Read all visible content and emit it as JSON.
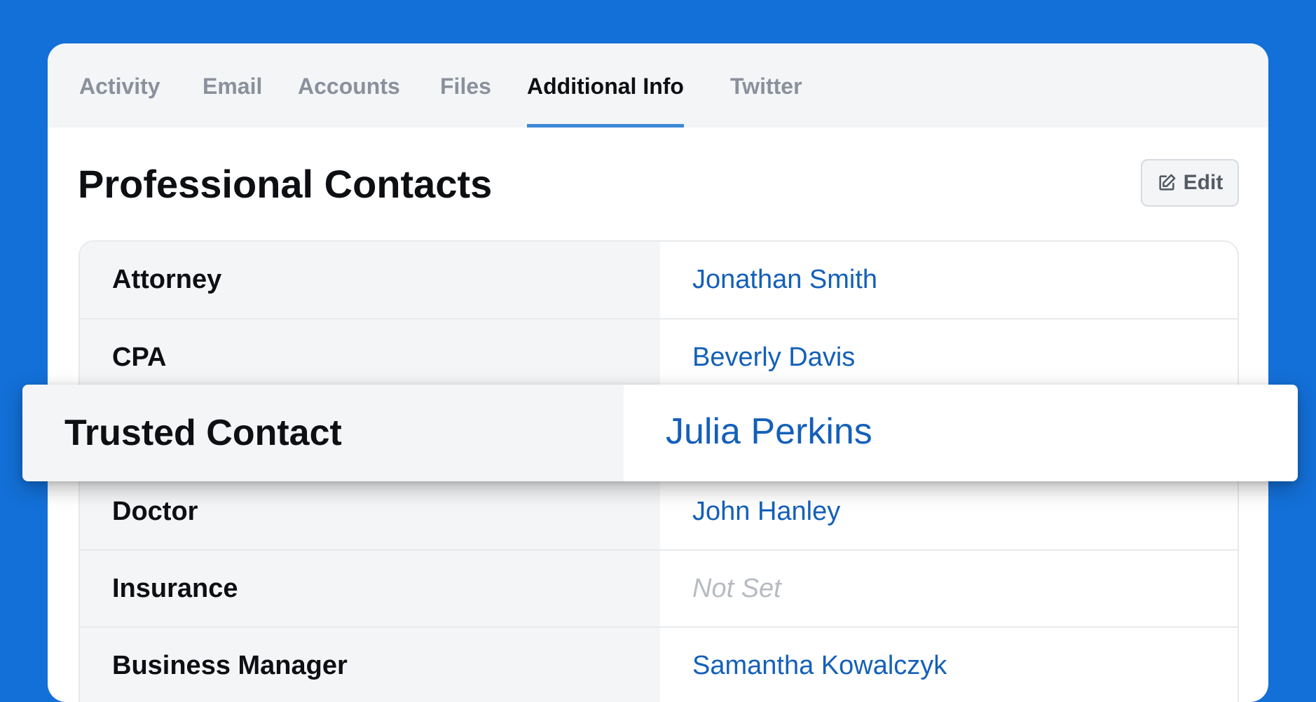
{
  "tabs": [
    {
      "label": "Activity"
    },
    {
      "label": "Email"
    },
    {
      "label": "Accounts"
    },
    {
      "label": "Files"
    },
    {
      "label": "Additional Info"
    },
    {
      "label": "Twitter"
    }
  ],
  "active_tab": "Additional Info",
  "section": {
    "title": "Professional Contacts",
    "edit_label": "Edit"
  },
  "contacts": [
    {
      "role": "Attorney",
      "name": "Jonathan Smith"
    },
    {
      "role": "CPA",
      "name": "Beverly Davis"
    },
    {
      "role": "Trusted Contact",
      "name": "Julia Perkins"
    },
    {
      "role": "Doctor",
      "name": "John Hanley"
    },
    {
      "role": "Insurance",
      "name": "Not Set"
    },
    {
      "role": "Business Manager",
      "name": "Samantha Kowalczyk"
    }
  ],
  "icons": {
    "edit": "edit-icon"
  },
  "colors": {
    "background": "#1370d8",
    "active_tab_underline": "#3c89d8",
    "link": "#1460b8",
    "placeholder": "#b6bbc2"
  }
}
